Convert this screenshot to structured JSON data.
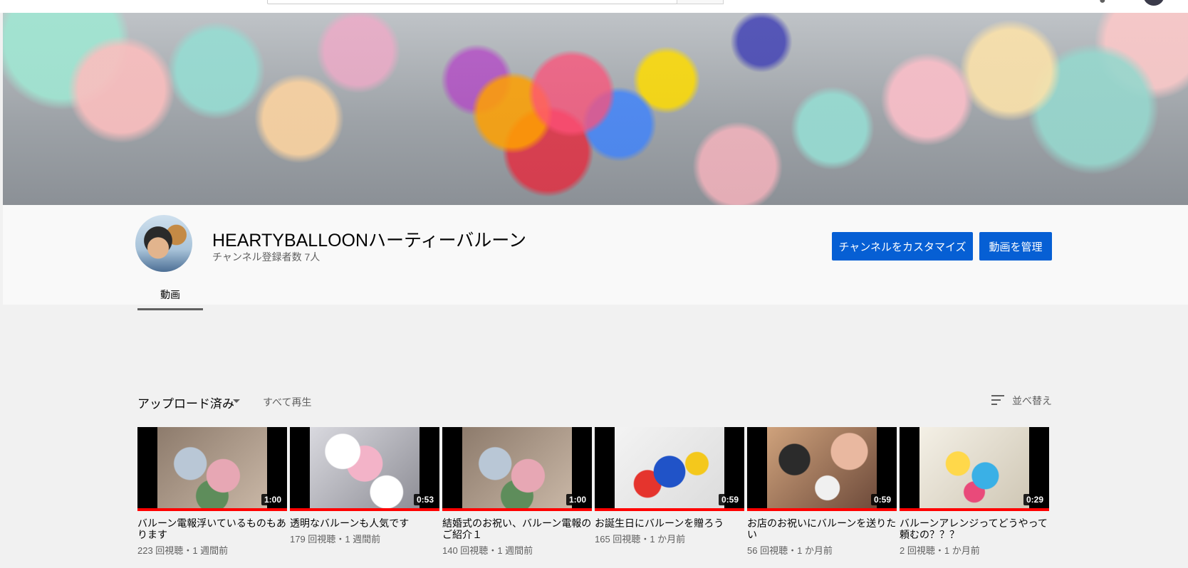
{
  "channel": {
    "name": "HEARTYBALLOONハーティーバルーン",
    "subscribers": "チャンネル登録者数 7人",
    "customize_label": "チャンネルをカスタマイズ",
    "manage_label": "動画を管理"
  },
  "tabs": [
    {
      "label": "動画",
      "active": true
    }
  ],
  "uploads": {
    "label": "アップロード済み",
    "play_all": "すべて再生",
    "sort_label": "並べ替え"
  },
  "videos": [
    {
      "title": "バルーン電報浮いているものもあります",
      "duration": "1:00",
      "views": "223 回視聴",
      "age": "1 週間前"
    },
    {
      "title": "透明なバルーンも人気です",
      "duration": "0:53",
      "views": "179 回視聴",
      "age": "1 週間前"
    },
    {
      "title": "結婚式のお祝い、バルーン電報のご紹介１",
      "duration": "1:00",
      "views": "140 回視聴",
      "age": "1 週間前"
    },
    {
      "title": "お誕生日にバルーンを贈ろう",
      "duration": "0:59",
      "views": "165 回視聴",
      "age": "1 か月前"
    },
    {
      "title": "お店のお祝いにバルーンを送りたい",
      "duration": "0:59",
      "views": "56 回視聴",
      "age": "1 か月前"
    },
    {
      "title": "バルーンアレンジってどうやって頼むの？？？",
      "duration": "0:29",
      "views": "2 回視聴",
      "age": "1 か月前"
    }
  ],
  "meta_separator": "・",
  "colors": {
    "accent_blue": "#065fd4",
    "progress_red": "#ff0000",
    "header_bg": "#f9f9f9",
    "page_bg": "#f1f1f1"
  }
}
